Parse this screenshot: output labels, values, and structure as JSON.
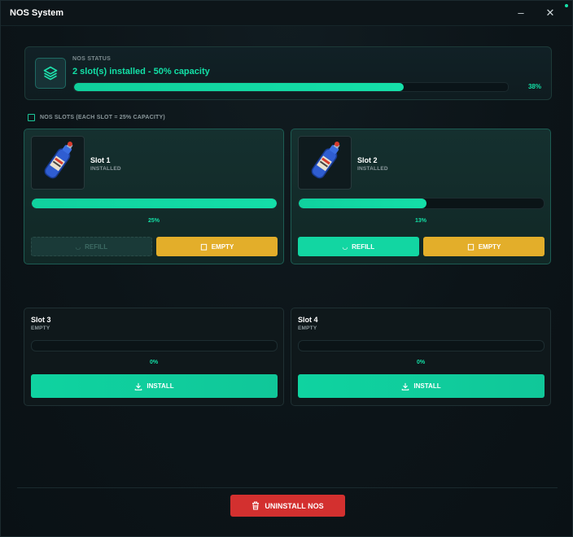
{
  "window": {
    "title": "NOS System",
    "minimize": "–",
    "close": "✕"
  },
  "status": {
    "label": "NOS STATUS",
    "value": "2 slot(s) installed - 50% capacity",
    "percent_text": "38%",
    "percent": 38
  },
  "section": {
    "title": "NOS SLOTS (EACH SLOT = 25% CAPACITY)"
  },
  "slots": [
    {
      "name": "Slot 1",
      "state": "INSTALLED",
      "percent_text": "25%",
      "percent": 100,
      "refill_label": "REFILL",
      "empty_label": "EMPTY",
      "refill_enabled": false
    },
    {
      "name": "Slot 2",
      "state": "INSTALLED",
      "percent_text": "13%",
      "percent": 52,
      "refill_label": "REFILL",
      "empty_label": "EMPTY",
      "refill_enabled": true
    },
    {
      "name": "Slot 3",
      "state": "EMPTY",
      "percent_text": "0%",
      "percent": 0,
      "install_label": "INSTALL"
    },
    {
      "name": "Slot 4",
      "state": "EMPTY",
      "percent_text": "0%",
      "percent": 0,
      "install_label": "INSTALL"
    }
  ],
  "footer": {
    "uninstall_label": "UNINSTALL NOS"
  },
  "colors": {
    "accent": "#12e0a6",
    "warning": "#e3ae2a",
    "danger": "#d3302f"
  },
  "icons": [
    "layers-icon",
    "nos-bottle-icon",
    "refill-icon",
    "trash-icon",
    "download-icon"
  ]
}
